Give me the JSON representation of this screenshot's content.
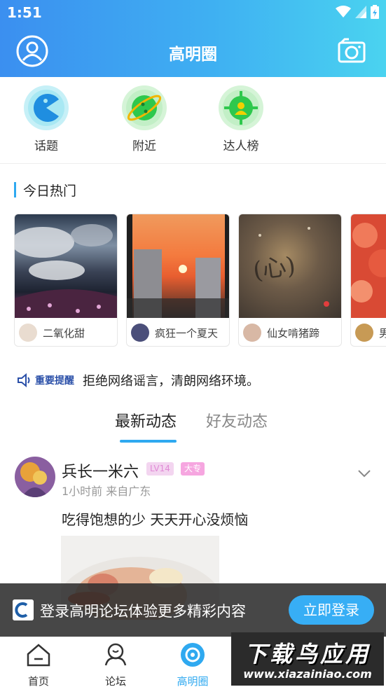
{
  "status": {
    "time": "1:51"
  },
  "header": {
    "title": "高明圈"
  },
  "quick_entries": [
    {
      "label": "话题",
      "icon": "pacman-topic-icon",
      "color": "#9be5f2"
    },
    {
      "label": "附近",
      "icon": "planet-nearby-icon",
      "color": "#bdeec1"
    },
    {
      "label": "达人榜",
      "icon": "target-person-icon",
      "color": "#bdeec1"
    }
  ],
  "hot": {
    "title": "今日热门",
    "cards": [
      {
        "name": "二氧化甜"
      },
      {
        "name": "疯狂一个夏天"
      },
      {
        "name": "仙女啃猪蹄"
      },
      {
        "name": "男"
      }
    ]
  },
  "notice": {
    "tag": "重要提醒",
    "text": "拒绝网络谣言，清朗网络环境。"
  },
  "tabs": {
    "active": "最新动态",
    "inactive": "好友动态"
  },
  "post": {
    "author": "兵长一米六",
    "level": "LV14",
    "education": "大专",
    "meta": "1小时前  来自广东",
    "text": "吃得饱想的少 天天开心没烦恼"
  },
  "login_banner": {
    "text": "登录高明论坛体验更多精彩内容",
    "button": "立即登录"
  },
  "bottom_nav": [
    {
      "label": "首页",
      "icon": "home-icon"
    },
    {
      "label": "论坛",
      "icon": "forum-icon"
    },
    {
      "label": "高明圈",
      "icon": "circle-icon"
    }
  ],
  "watermark": {
    "big": "下载鸟应用",
    "small": "www.xiazainiao.com"
  },
  "colors": {
    "accent": "#2fa9f0",
    "header_start": "#3b8ff0",
    "header_end": "#4ad3f0"
  }
}
